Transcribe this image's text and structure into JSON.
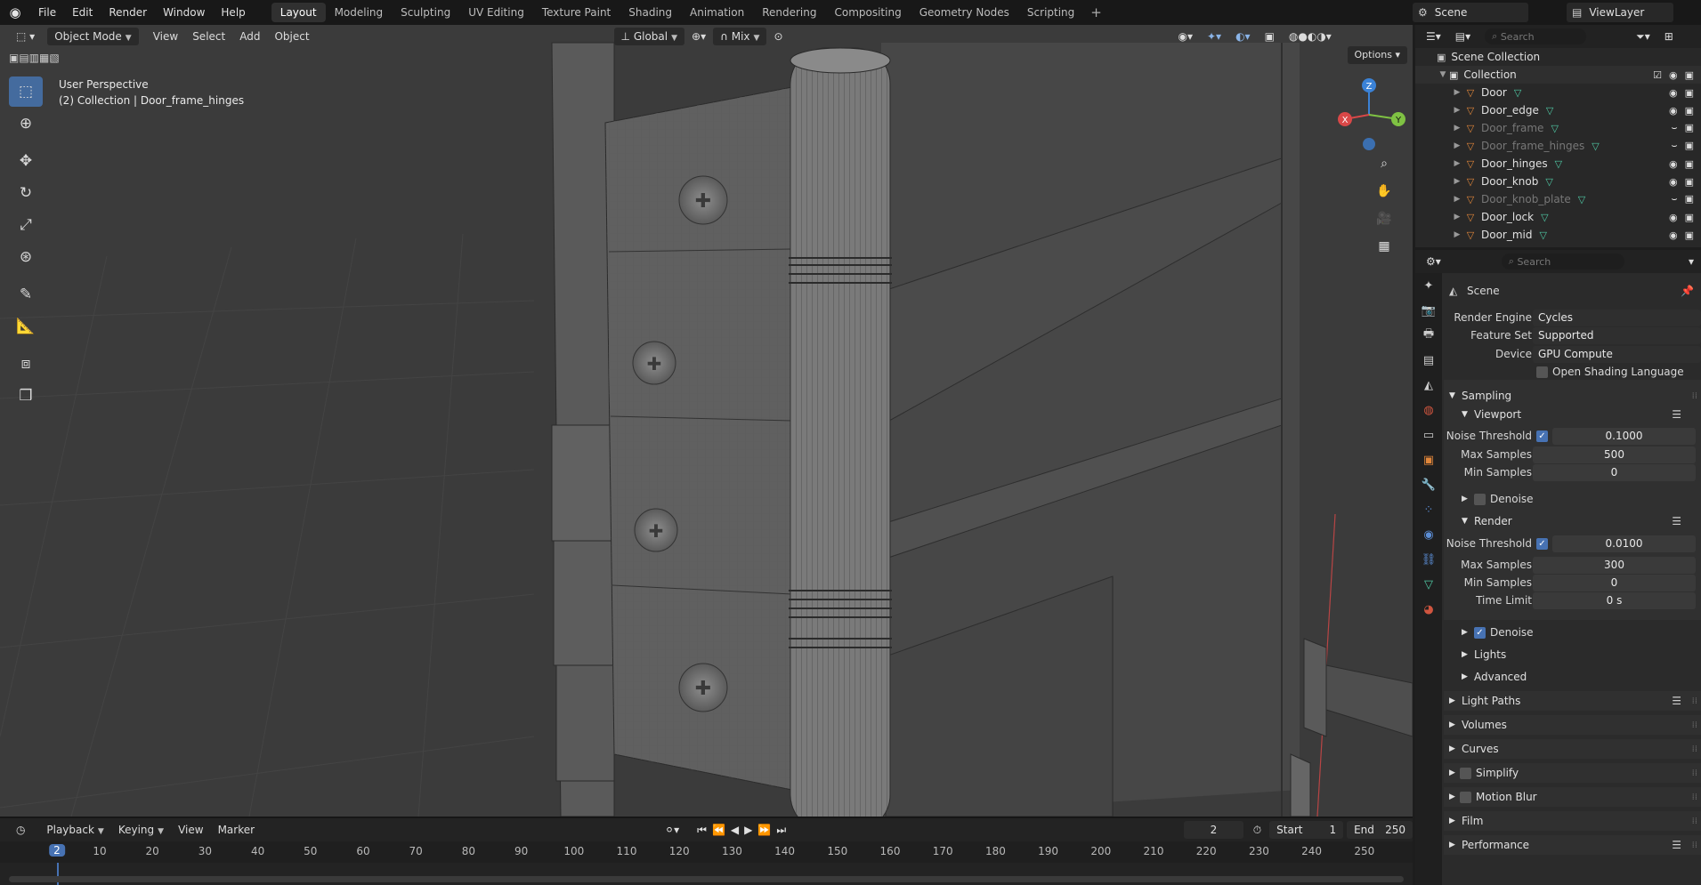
{
  "app": {
    "menu": [
      "File",
      "Edit",
      "Render",
      "Window",
      "Help"
    ],
    "workspaces": [
      "Layout",
      "Modeling",
      "Sculpting",
      "UV Editing",
      "Texture Paint",
      "Shading",
      "Animation",
      "Rendering",
      "Compositing",
      "Geometry Nodes",
      "Scripting"
    ],
    "active_workspace": "Layout",
    "scene_name": "Scene",
    "view_layer": "ViewLayer"
  },
  "viewport": {
    "mode": "Object Mode",
    "menus": [
      "View",
      "Select",
      "Add",
      "Object"
    ],
    "transform_orientation": "Global",
    "snap_mode": "Mix",
    "options_label": "Options",
    "info_line1": "User Perspective",
    "info_line2": "(2) Collection | Door_frame_hinges",
    "axis_x": "X",
    "axis_y": "Y",
    "axis_z": "Z"
  },
  "timeline": {
    "menus": [
      "Playback",
      "Keying",
      "View",
      "Marker"
    ],
    "current_frame": "2",
    "start_label": "Start",
    "start_value": "1",
    "end_label": "End",
    "end_value": "250",
    "ticks": [
      "10",
      "20",
      "30",
      "40",
      "50",
      "60",
      "70",
      "80",
      "90",
      "100",
      "110",
      "120",
      "130",
      "140",
      "150",
      "160",
      "170",
      "180",
      "190",
      "200",
      "210",
      "220",
      "230",
      "240",
      "250"
    ]
  },
  "outliner": {
    "search_placeholder": "Search",
    "scene_collection": "Scene Collection",
    "collection": "Collection",
    "items": [
      {
        "name": "Door",
        "dim": false
      },
      {
        "name": "Door_edge",
        "dim": false
      },
      {
        "name": "Door_frame",
        "dim": true
      },
      {
        "name": "Door_frame_hinges",
        "dim": true
      },
      {
        "name": "Door_hinges",
        "dim": false
      },
      {
        "name": "Door_knob",
        "dim": false
      },
      {
        "name": "Door_knob_plate",
        "dim": true
      },
      {
        "name": "Door_lock",
        "dim": false
      },
      {
        "name": "Door_mid",
        "dim": false
      }
    ]
  },
  "properties": {
    "search_placeholder": "Search",
    "context": "Scene",
    "render_engine_label": "Render Engine",
    "render_engine": "Cycles",
    "feature_set_label": "Feature Set",
    "feature_set": "Supported",
    "device_label": "Device",
    "device": "GPU Compute",
    "osl_label": "Open Shading Language",
    "sampling": "Sampling",
    "viewport": "Viewport",
    "noise_threshold_label": "Noise Threshold",
    "viewport_noise_threshold": "0.1000",
    "max_samples_label": "Max Samples",
    "viewport_max_samples": "500",
    "min_samples_label": "Min Samples",
    "viewport_min_samples": "0",
    "denoise_label": "Denoise",
    "render": "Render",
    "render_noise_threshold": "0.0100",
    "render_max_samples": "300",
    "render_min_samples": "0",
    "time_limit_label": "Time Limit",
    "time_limit": "0 s",
    "lights": "Lights",
    "advanced": "Advanced",
    "light_paths": "Light Paths",
    "volumes": "Volumes",
    "curves": "Curves",
    "simplify": "Simplify",
    "motion_blur": "Motion Blur",
    "film": "Film",
    "performance": "Performance"
  }
}
